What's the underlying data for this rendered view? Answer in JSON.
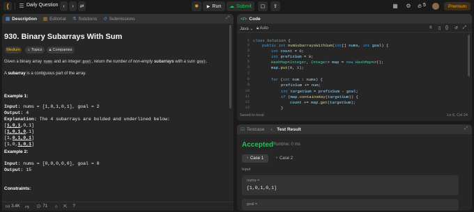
{
  "topbar": {
    "logo_icon": "leetcode-logo-icon",
    "problem_list_label": "Daily Question",
    "run_label": "Run",
    "submit_label": "Submit",
    "streak_count": "5",
    "premium_label": "Premium",
    "accent": "#ffa116",
    "submit_color": "#2cbb5d"
  },
  "left_tabs": [
    {
      "label": "Description",
      "icon": "description-icon"
    },
    {
      "label": "Editorial",
      "icon": "book-icon"
    },
    {
      "label": "Solutions",
      "icon": "flask-icon"
    },
    {
      "label": "Submissions",
      "icon": "history-icon"
    }
  ],
  "problem": {
    "title": "930. Binary Subarrays With Sum",
    "difficulty": "Medium",
    "topics_label": "Topics",
    "companies_label": "Companies",
    "desc_1": "Given a binary array ",
    "desc_nums": "nums",
    "desc_2": " and an integer ",
    "desc_goal": "goal",
    "desc_3": ", return ",
    "desc_4": "the number of non-empty ",
    "desc_5": "subarrays",
    "desc_6": " with a sum ",
    "desc_goal2": "goal",
    "desc_end": ".",
    "subarray_1": "A ",
    "subarray_2": "subarray",
    "subarray_3": " is a contiguous part of the array.",
    "ex1_title": "Example 1:",
    "ex1_input_label": "Input:",
    "ex1_input": " nums = [1,0,1,0,1], goal = 2",
    "ex1_output_label": "Output:",
    "ex1_output": " 4",
    "ex1_expl_label": "Explanation:",
    "ex1_expl": " The 4 subarrays are bolded and underlined below:",
    "ex2_title": "Example 2:",
    "ex2_input_label": "Input:",
    "ex2_input": " nums = [0,0,0,0,0], goal = 0",
    "ex2_output_label": "Output:",
    "ex2_output": " 15",
    "constraints_title": "Constraints:",
    "likes": "3.4K",
    "comments": "71"
  },
  "code_panel": {
    "header": "Code",
    "language": "Java",
    "mode": "Auto",
    "saved_status": "Saved to local",
    "cursor_pos": "Ln 6, Col 24"
  },
  "result_panel": {
    "testcase_tab": "Testcase",
    "result_tab": "Test Result",
    "status": "Accepted",
    "runtime": "Runtime: 0 ms",
    "case1": "Case 1",
    "case2": "Case 2",
    "input_label": "Input",
    "nums_label": "nums =",
    "nums_value": "[1,0,1,0,1]",
    "goal_label": "goal =",
    "accepted_color": "#2cbb5d"
  }
}
